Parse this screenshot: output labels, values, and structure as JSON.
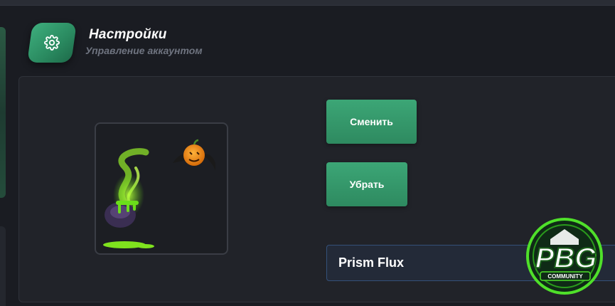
{
  "header": {
    "title": "Настройки",
    "subtitle": "Управление аккаунтом",
    "icon": "gear-icon"
  },
  "avatar": {
    "description_icon": "halloween-cauldron-pumpkin-avatar"
  },
  "actions": {
    "change_label": "Сменить",
    "remove_label": "Убрать"
  },
  "name_field": {
    "value": "Prism Flux"
  },
  "watermark": {
    "brand": "PBG",
    "tagline": "COMMUNITY"
  },
  "colors": {
    "accent": "#3ca676",
    "background": "#1a1c22",
    "panel": "#212329"
  }
}
